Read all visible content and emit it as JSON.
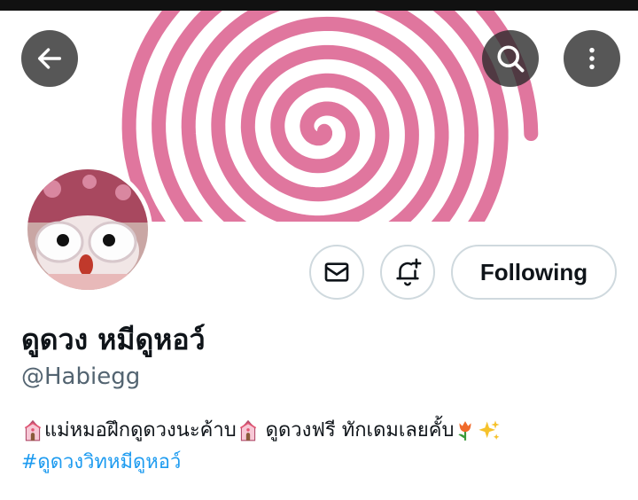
{
  "header": {
    "back_icon": "arrow-left-icon",
    "search_icon": "search-icon",
    "more_icon": "more-vertical-icon"
  },
  "banner": {
    "pattern": "pink-spiral",
    "colors": {
      "stripe": "#e0769e",
      "background": "#ffffff"
    }
  },
  "profile": {
    "display_name": "ดูดวง หมีดูหอว์",
    "handle": "@Habiegg",
    "bio_part1": "แม่หมอฝึกดูดวงนะค้าบ",
    "bio_part2": " ดูดวงฟรี ทักเดมเลยคั้บ",
    "hashtag": "#ดูดวงวิทหมีดูหอว์",
    "bio_emojis": [
      "wedding-chapel-emoji",
      "wedding-chapel-emoji",
      "tulip-emoji",
      "sparkles-emoji"
    ]
  },
  "actions": {
    "message_icon": "envelope-icon",
    "notify_icon": "bell-plus-icon",
    "follow_label": "Following"
  },
  "colors": {
    "link": "#1d9bf0",
    "secondary_text": "#536471",
    "button_border": "#cfd9de"
  }
}
